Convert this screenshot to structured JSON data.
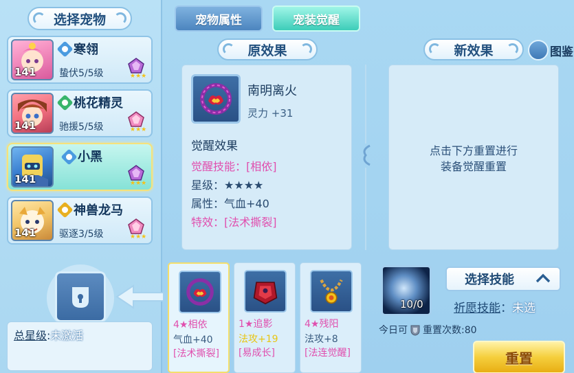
{
  "left": {
    "title": "选择宠物",
    "pets": [
      {
        "name": "寒翎",
        "sub": "蛰伏5/5级",
        "level": "141",
        "type_color": "#4a9be0"
      },
      {
        "name": "桃花精灵",
        "sub": "驰援5/5级",
        "level": "141",
        "type_color": "#39b56b"
      },
      {
        "name": "小黑",
        "sub": "",
        "level": "141",
        "type_color": "#4a9be0"
      },
      {
        "name": "神兽龙马",
        "sub": "驱逐3/5级",
        "level": "141",
        "type_color": "#e8b020"
      }
    ],
    "star_level_label": "总星级",
    "star_level_sep": ":",
    "star_level_value": "未激活"
  },
  "tabs": {
    "attrs": "宠物属性",
    "awaken": "宠装觉醒"
  },
  "original": {
    "header": "原效果",
    "equip_name": "南明离火",
    "equip_stat": "灵力 +31",
    "wake_title": "觉醒效果",
    "skill_line": "觉醒技能：[相依]",
    "star_line": "星级：★★★★",
    "attr_line": "属性：气血+40",
    "special_line": "特效：[法术撕裂]"
  },
  "new_effect": {
    "header": "新效果",
    "hint_line1": "点击下方重置进行",
    "hint_line2": "装备觉醒重置",
    "catalog": "图鉴"
  },
  "slots": [
    {
      "l1": "4★相依",
      "l2": "气血+40",
      "l3": "[法术撕裂]",
      "l1_color": "#e04fae",
      "l3_color": "#e04fae"
    },
    {
      "l1": "1★追影",
      "l2": "法攻+19",
      "l3": "[易成长]",
      "l1_color": "#e04fae",
      "l2_color": "#e8c513",
      "l3_color": "#e04fae"
    },
    {
      "l1": "4★残阳",
      "l2": "法攻+8",
      "l3": "[法连觉醒]",
      "l1_color": "#e04fae",
      "l3_color": "#e04fae"
    }
  ],
  "skill": {
    "count": "10/0",
    "select_btn": "选择技能",
    "wish_label": "祈愿技能",
    "wish_sep": "：",
    "wish_value": "未选",
    "today_prefix": "今日可",
    "today_suffix": "重置次数:80",
    "reset_btn": "重置"
  }
}
